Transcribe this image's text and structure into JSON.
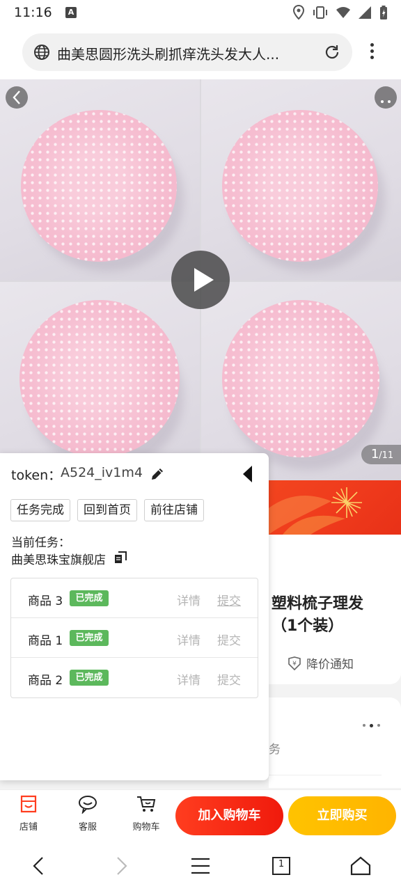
{
  "status_bar": {
    "time": "11:16",
    "notification_icon": "A"
  },
  "url_bar": {
    "url_text": "曲美思圆形洗头刷抓痒洗头发大人..."
  },
  "gallery": {
    "current_page": "1",
    "total_pages": "/11"
  },
  "product": {
    "title": "塑料梳子理发\n（1个装）",
    "price_notify_label": "降价通知",
    "service_partial_text": "服务"
  },
  "panel": {
    "token_label": "token：",
    "token_value": "A524_iv1m4",
    "buttons": [
      "任务完成",
      "回到首页",
      "前往店铺"
    ],
    "current_task_label": "当前任务：",
    "store_name": "曲美思珠宝旗舰店",
    "tasks": [
      {
        "name": "商品 3",
        "status": "已完成",
        "detail": "详情",
        "submit": "提交"
      },
      {
        "name": "商品 1",
        "status": "已完成",
        "detail": "详情",
        "submit": "提交"
      },
      {
        "name": "商品 2",
        "status": "已完成",
        "detail": "详情",
        "submit": "提交"
      }
    ]
  },
  "action_bar": {
    "store_label": "店铺",
    "service_label": "客服",
    "cart_label": "购物车",
    "add_to_cart_label": "加入购物车",
    "buy_now_label": "立即购买"
  },
  "nav_bar": {
    "tab_count": "1"
  },
  "colors": {
    "accent_red": "#f01a0c",
    "accent_yellow": "#ffb400",
    "badge_green": "#5cb85c",
    "brush_pink": "#f7c2d3"
  },
  "icons": [
    "globe-icon",
    "reload-icon",
    "more-vert-icon",
    "play-icon",
    "edit-icon",
    "collapse-left-icon",
    "copy-icon",
    "store-icon",
    "customer-service-icon",
    "cart-icon",
    "price-tag-icon",
    "back-nav-icon",
    "forward-nav-icon",
    "menu-nav-icon",
    "tabs-nav-icon",
    "home-nav-icon"
  ]
}
